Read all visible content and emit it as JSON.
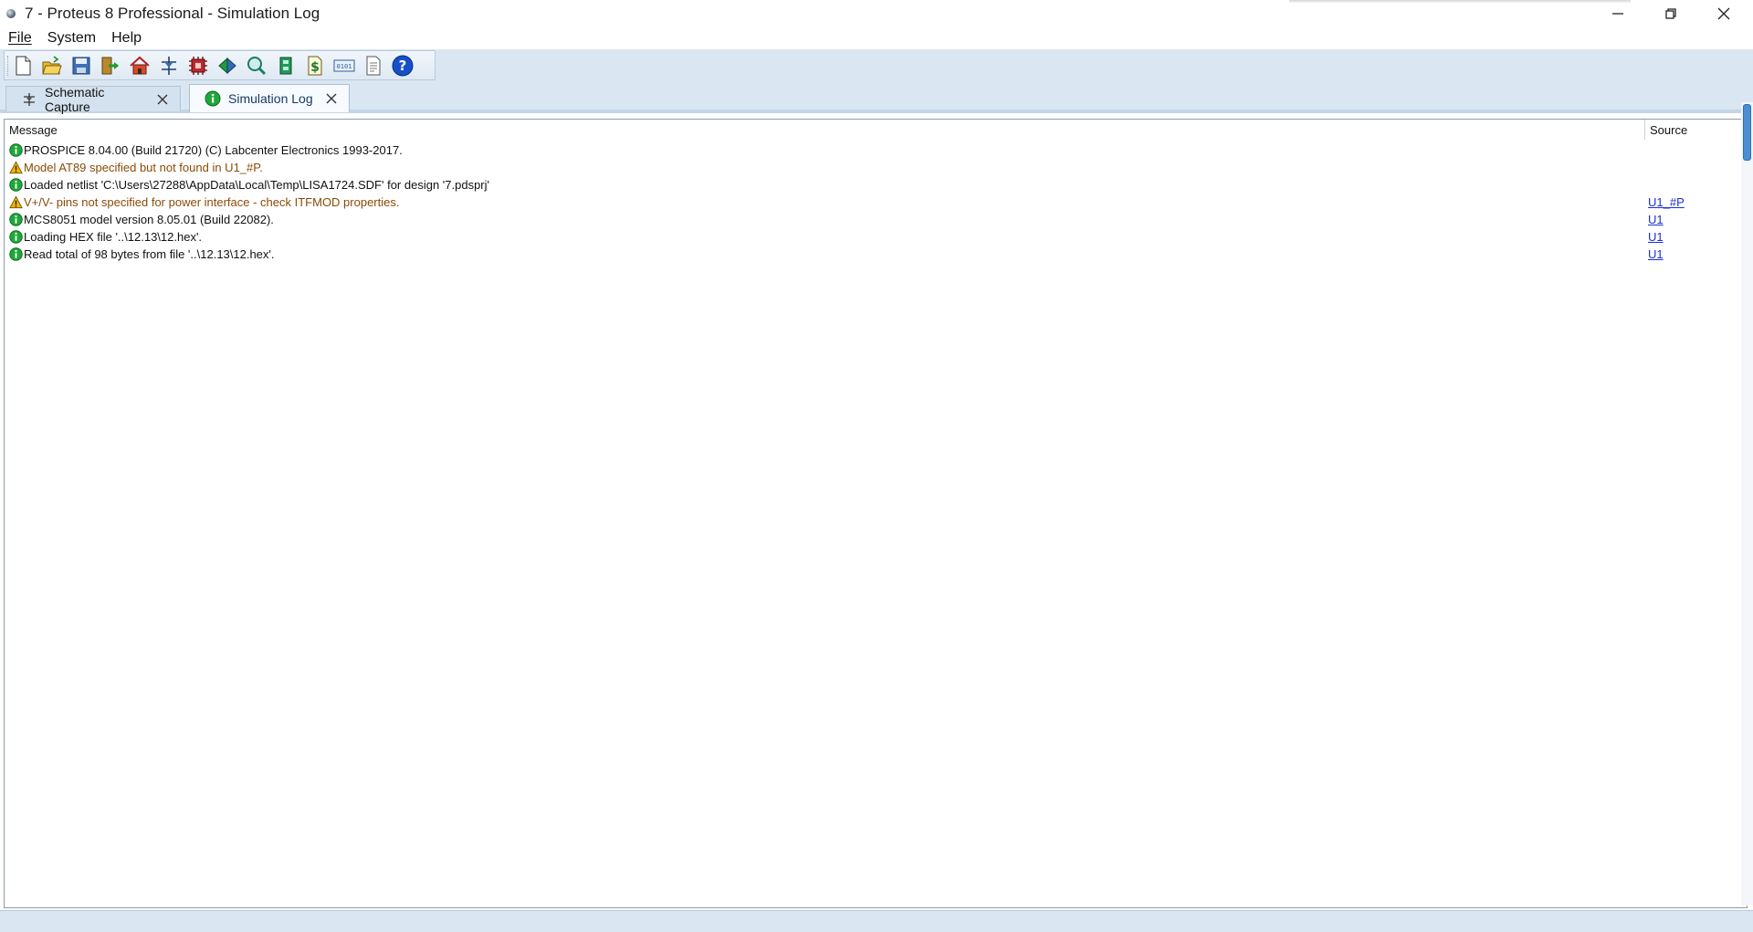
{
  "window": {
    "title": "7 - Proteus 8 Professional - Simulation Log"
  },
  "menu": {
    "items": [
      "File",
      "System",
      "Help"
    ]
  },
  "toolbar": {
    "buttons": [
      "new-project-icon",
      "open-project-icon",
      "save-project-icon",
      "close-project-icon",
      "home-page-icon",
      "schematic-capture-icon",
      "pcb-layout-icon",
      "3d-visualizer-icon",
      "gerber-viewer-icon",
      "design-explorer-icon",
      "bill-of-materials-icon",
      "source-code-icon",
      "project-notes-icon",
      "help-icon"
    ]
  },
  "tabs": [
    {
      "label": "Schematic Capture",
      "icon": "schematic-icon",
      "active": false
    },
    {
      "label": "Simulation Log",
      "icon": "info-icon",
      "active": true
    }
  ],
  "log": {
    "columns": {
      "message": "Message",
      "source": "Source"
    },
    "rows": [
      {
        "type": "info",
        "message": "PROSPICE 8.04.00 (Build 21720) (C) Labcenter Electronics 1993-2017.",
        "source": ""
      },
      {
        "type": "warning",
        "message": "Model AT89 specified but not found in U1_#P.",
        "source": ""
      },
      {
        "type": "info",
        "message": "Loaded netlist 'C:\\Users\\27288\\AppData\\Local\\Temp\\LISA1724.SDF' for design '7.pdsprj'",
        "source": ""
      },
      {
        "type": "warning",
        "message": "V+/V- pins not specified for power interface - check ITFMOD properties.",
        "source": "U1_#P"
      },
      {
        "type": "info",
        "message": "MCS8051 model version 8.05.01 (Build 22082).",
        "source": "U1"
      },
      {
        "type": "info",
        "message": "Loading HEX file '..\\12.13\\12.hex'.",
        "source": "U1"
      },
      {
        "type": "info",
        "message": "Read total of 98 bytes from file '..\\12.13\\12.hex'.",
        "source": "U1"
      }
    ]
  },
  "colors": {
    "toolbar_bg": "#dae6f1",
    "warning_text": "#8a4a06",
    "link": "#1b2fd6",
    "info_icon": "#1fa83a",
    "warning_icon": "#f2b600"
  }
}
